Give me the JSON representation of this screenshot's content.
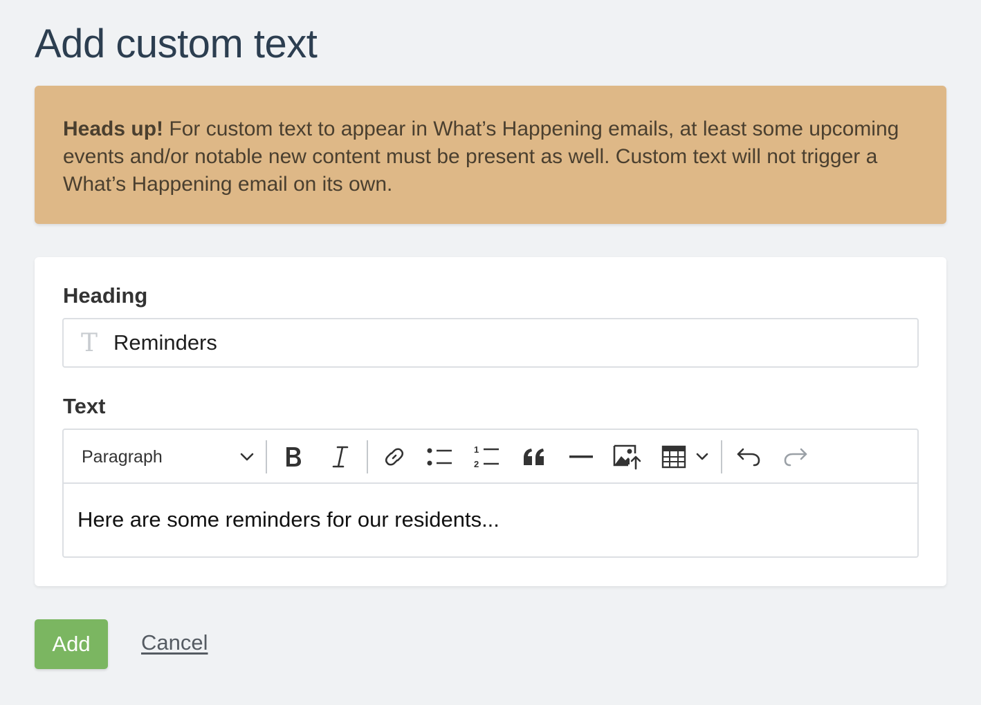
{
  "page": {
    "title": "Add custom text"
  },
  "alert": {
    "strong": "Heads up!",
    "message": " For custom text to appear in What’s Happening emails, at least some upcoming events and/or notable new content must be present as well. Custom text will not trigger a What’s Happening email on its own."
  },
  "form": {
    "heading_label": "Heading",
    "heading_value": "Reminders",
    "text_label": "Text",
    "editor": {
      "paragraph_style": "Paragraph",
      "content": "Here are some reminders for our residents..."
    },
    "toolbar_icons": [
      "bold-icon",
      "italic-icon",
      "link-icon",
      "bulleted-list-icon",
      "numbered-list-icon",
      "blockquote-icon",
      "horizontal-line-icon",
      "image-upload-icon",
      "table-icon",
      "undo-icon",
      "redo-icon"
    ]
  },
  "actions": {
    "add_label": "Add",
    "cancel_label": "Cancel"
  },
  "colors": {
    "alert_bg": "#deb887",
    "add_button": "#7bb661",
    "title": "#2c3e50"
  }
}
